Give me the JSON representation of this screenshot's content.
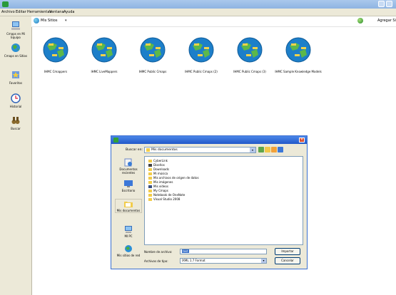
{
  "window": {
    "icon": "app-icon"
  },
  "menu": [
    "Archivo",
    "Editar",
    "Herramientas",
    "Ventana",
    "Ayuda"
  ],
  "sidebar": [
    {
      "label": "Cmaps en Mi Equipo",
      "icon": "computer-icon"
    },
    {
      "label": "Cmaps en Sitios",
      "icon": "globe-icon"
    },
    {
      "label": "Favoritos",
      "icon": "favorites-icon"
    },
    {
      "label": "Historial",
      "icon": "history-icon"
    },
    {
      "label": "Buscar",
      "icon": "binoculars-icon"
    }
  ],
  "toolbar": {
    "site_label": "Mis Sitios",
    "add_label": "Agregar Si"
  },
  "sites": [
    "IHMC Cmappers",
    "IHMC LiveMappers",
    "IHMC Public Cmaps",
    "IHMC Public Cmaps (2)",
    "IHMC Public Cmaps (3)",
    "IHMC Sample Knowledge Models"
  ],
  "dialog": {
    "lookin_label": "Buscar en:",
    "lookin_value": "Mis documentos",
    "places": [
      "Documentos recientes",
      "Escritorio",
      "Mis documentos",
      "MI PC",
      "Mis sitios de red"
    ],
    "files": [
      "CyberLink",
      "Diseños",
      "Downloads",
      "Mi música",
      "Mis archivos de origen de datos",
      "Mis imágenes",
      "Mis vídeos",
      "My Cmaps",
      "Notebook de OneNote",
      "Visual Studio 2008"
    ],
    "filename_label": "Nombre de archivo:",
    "filename_value": "test",
    "filetype_label": "Archivos de tipo:",
    "filetype_value": "IXML 1.7 Format",
    "import_button": "Importar",
    "cancel_button": "Cancelar"
  }
}
